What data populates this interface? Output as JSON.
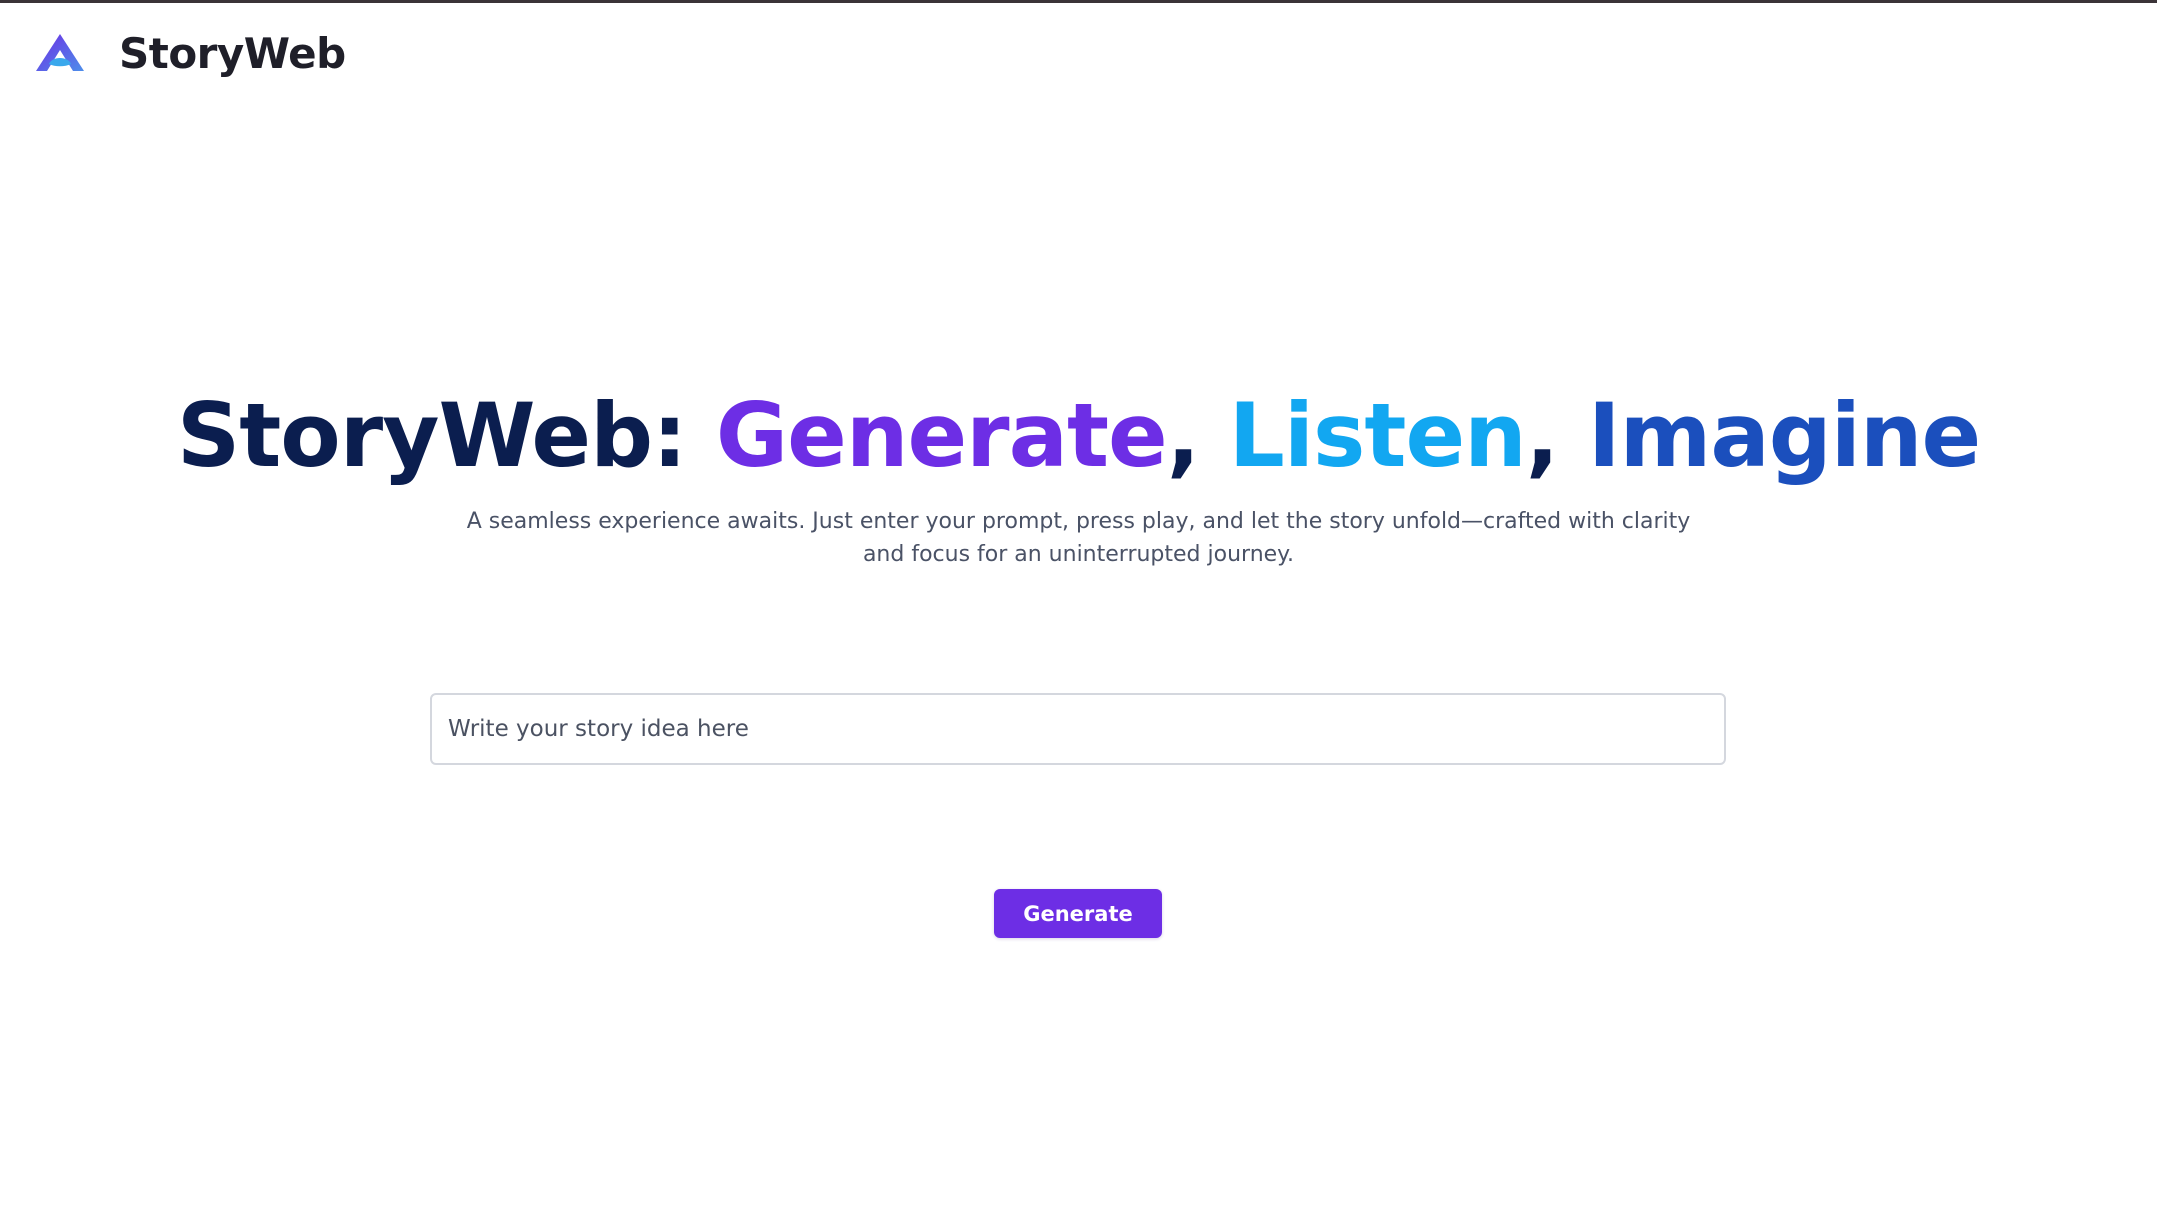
{
  "app": {
    "name": "StoryWeb",
    "logo_icon": "storyweb-logo-icon"
  },
  "hero": {
    "title_prefix": "StoryWeb: ",
    "title_word_1": "Generate",
    "separator_1": ", ",
    "title_word_2": "Listen",
    "separator_2": ", ",
    "title_word_3": "Imagine",
    "subtitle": "A seamless experience awaits. Just enter your prompt, press play, and let the story unfold—crafted with clarity and focus for an uninterrupted journey."
  },
  "prompt": {
    "value": "",
    "placeholder": "Write your story idea here"
  },
  "actions": {
    "generate_label": "Generate"
  },
  "colors": {
    "navy": "#0b1e4f",
    "purple": "#6d2ee5",
    "sky": "#12a7f1",
    "blue": "#1b4fbd"
  }
}
